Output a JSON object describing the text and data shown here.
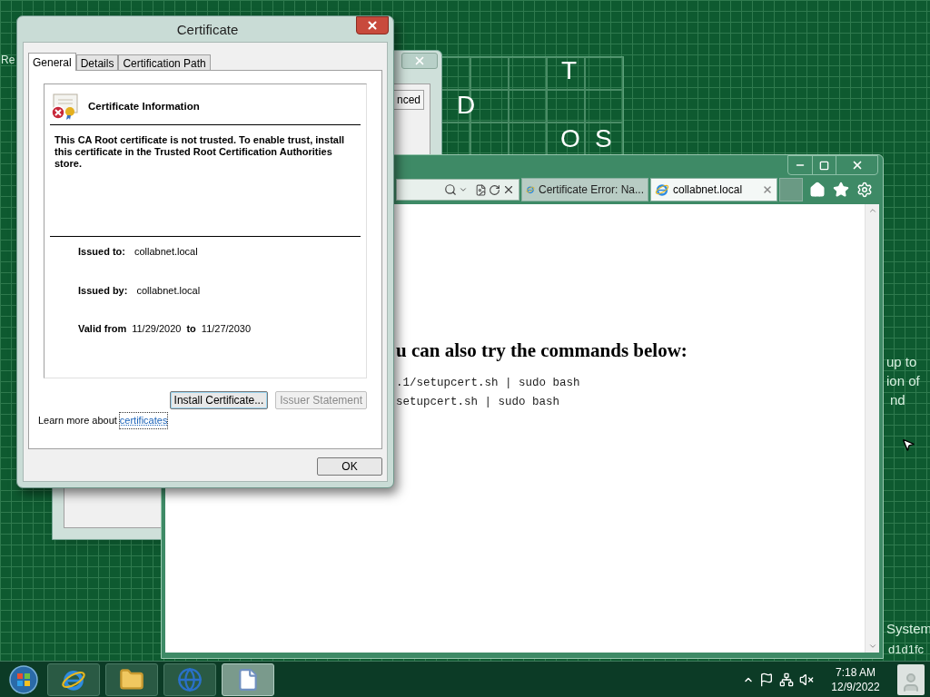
{
  "desktop": {
    "tiles": [
      "T",
      "D",
      "O",
      "S"
    ],
    "fragments": [
      "Re",
      "up to",
      "ion of",
      "nd",
      "System",
      "d1d1fc"
    ]
  },
  "back_window": {
    "tab": "nced"
  },
  "browser": {
    "tabs": [
      {
        "label": "Certificate Error: Na...",
        "selected": false
      },
      {
        "label": "collabnet.local",
        "selected": true
      }
    ],
    "heading": "u can also try the commands below:",
    "code_lines": [
      ".1/setupcert.sh | sudo bash",
      "setupcert.sh | sudo bash"
    ]
  },
  "dialog": {
    "title": "Certificate",
    "tabs": [
      {
        "label": "General",
        "selected": true
      },
      {
        "label": "Details",
        "selected": false
      },
      {
        "label": "Certification Path",
        "selected": false
      }
    ],
    "info_title": "Certificate Information",
    "message": "This CA Root certificate is not trusted. To enable trust, install this certificate in the Trusted Root Certification Authorities store.",
    "fields": [
      {
        "label": "Issued to:",
        "value": "collabnet.local"
      },
      {
        "label": "Issued by:",
        "value": "collabnet.local"
      }
    ],
    "validity": {
      "label": "Valid from",
      "from": "11/29/2020",
      "to_label": "to",
      "to": "11/27/2030"
    },
    "buttons": [
      {
        "label": "Install Certificate...",
        "focused": true,
        "disabled": false
      },
      {
        "label": "Issuer Statement",
        "focused": false,
        "disabled": true
      }
    ],
    "learn_more": {
      "text": "Learn more about",
      "link": "certificates"
    },
    "ok": "OK"
  },
  "taskbar": {
    "apps": [
      {
        "kind": "browser",
        "selected": false
      },
      {
        "kind": "folder",
        "selected": false
      },
      {
        "kind": "globe",
        "selected": false
      },
      {
        "kind": "document",
        "selected": true
      }
    ],
    "time": "7:18 AM",
    "date": "12/9/2022"
  }
}
